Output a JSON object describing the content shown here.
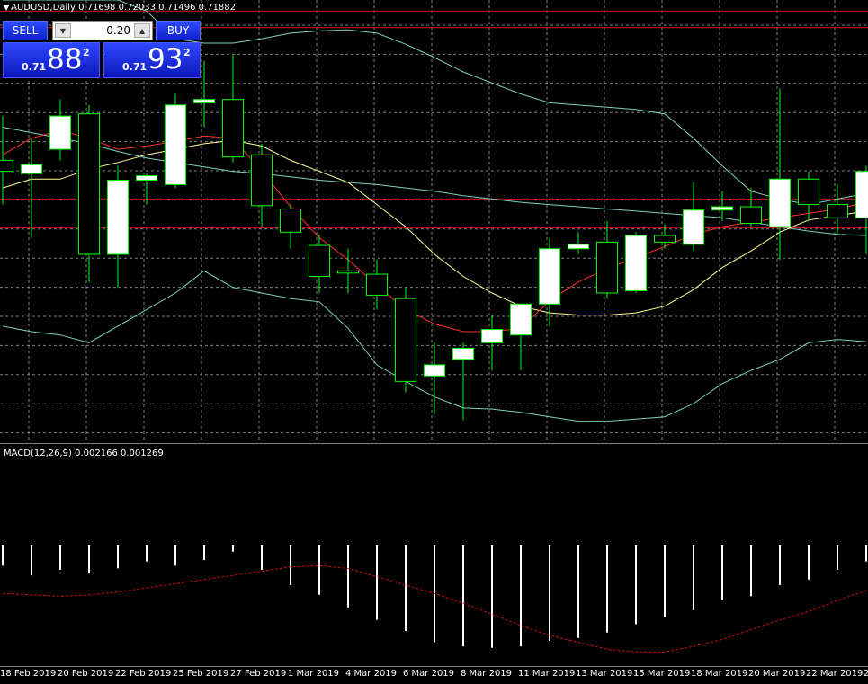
{
  "header": {
    "symbol_title": "AUDUSD,Daily",
    "ohlc": "0.71698 0.72033 0.71496 0.71882"
  },
  "trade_panel": {
    "sell_label": "SELL",
    "buy_label": "BUY",
    "lot": "0.20",
    "sell_price_prefix": "0.71",
    "sell_price_big": "88",
    "sell_price_sup": "2",
    "buy_price_prefix": "0.71",
    "buy_price_big": "93",
    "buy_price_sup": "2"
  },
  "indicator": {
    "title": "MACD(12,26,9) 0.002166 0.001269"
  },
  "colors": {
    "background": "#000000",
    "grid": "#808080",
    "candle_border": "#00ff00",
    "bull_fill": "#ffffff",
    "bear_fill": "#000000",
    "fast_ma": "#ff3030",
    "slow_ma": "#ffff99",
    "bands": "#7fd0c0",
    "red_level": "#d01010",
    "macd_signal": "#cc1111"
  },
  "chart_data": {
    "type": "candlestick",
    "x_labels": [
      "18 Feb 2019",
      "20 Feb 2019",
      "22 Feb 2019",
      "25 Feb 2019",
      "27 Feb 2019",
      "1 Mar 2019",
      "4 Mar 2019",
      "6 Mar 2019",
      "8 Mar 2019",
      "11 Mar 2019",
      "13 Mar 2019",
      "15 Mar 2019",
      "18 Mar 2019",
      "20 Mar 2019",
      "22 Mar 2019",
      "2"
    ],
    "candles": [
      {
        "o": 0.712,
        "h": 0.716,
        "l": 0.708,
        "c": 0.711
      },
      {
        "o": 0.7108,
        "h": 0.714,
        "l": 0.705,
        "c": 0.7116
      },
      {
        "o": 0.713,
        "h": 0.7175,
        "l": 0.712,
        "c": 0.716
      },
      {
        "o": 0.7162,
        "h": 0.717,
        "l": 0.701,
        "c": 0.7035
      },
      {
        "o": 0.7035,
        "h": 0.7115,
        "l": 0.7005,
        "c": 0.7102
      },
      {
        "o": 0.7102,
        "h": 0.7108,
        "l": 0.708,
        "c": 0.7106
      },
      {
        "o": 0.7098,
        "h": 0.718,
        "l": 0.7095,
        "c": 0.717
      },
      {
        "o": 0.7172,
        "h": 0.721,
        "l": 0.715,
        "c": 0.7175
      },
      {
        "o": 0.7175,
        "h": 0.7215,
        "l": 0.7118,
        "c": 0.7123
      },
      {
        "o": 0.7125,
        "h": 0.7135,
        "l": 0.706,
        "c": 0.7079
      },
      {
        "o": 0.7076,
        "h": 0.708,
        "l": 0.704,
        "c": 0.7055
      },
      {
        "o": 0.7043,
        "h": 0.7053,
        "l": 0.7,
        "c": 0.7015
      },
      {
        "o": 0.702,
        "h": 0.704,
        "l": 0.7,
        "c": 0.7018
      },
      {
        "o": 0.7017,
        "h": 0.703,
        "l": 0.6985,
        "c": 0.6998
      },
      {
        "o": 0.6995,
        "h": 0.7005,
        "l": 0.691,
        "c": 0.692
      },
      {
        "o": 0.6925,
        "h": 0.6955,
        "l": 0.689,
        "c": 0.6935
      },
      {
        "o": 0.694,
        "h": 0.6955,
        "l": 0.6885,
        "c": 0.695
      },
      {
        "o": 0.6955,
        "h": 0.698,
        "l": 0.693,
        "c": 0.6967
      },
      {
        "o": 0.6962,
        "h": 0.699,
        "l": 0.693,
        "c": 0.699
      },
      {
        "o": 0.699,
        "h": 0.705,
        "l": 0.697,
        "c": 0.704
      },
      {
        "o": 0.704,
        "h": 0.7055,
        "l": 0.7035,
        "c": 0.7044
      },
      {
        "o": 0.7046,
        "h": 0.7065,
        "l": 0.6995,
        "c": 0.7
      },
      {
        "o": 0.7002,
        "h": 0.7055,
        "l": 0.7,
        "c": 0.7052
      },
      {
        "o": 0.7052,
        "h": 0.7062,
        "l": 0.704,
        "c": 0.7046
      },
      {
        "o": 0.7044,
        "h": 0.71,
        "l": 0.7038,
        "c": 0.7075
      },
      {
        "o": 0.7075,
        "h": 0.7092,
        "l": 0.7065,
        "c": 0.7078
      },
      {
        "o": 0.7078,
        "h": 0.7095,
        "l": 0.706,
        "c": 0.7063
      },
      {
        "o": 0.706,
        "h": 0.7185,
        "l": 0.703,
        "c": 0.7103
      },
      {
        "o": 0.7103,
        "h": 0.711,
        "l": 0.7065,
        "c": 0.708
      },
      {
        "o": 0.708,
        "h": 0.7098,
        "l": 0.7053,
        "c": 0.7068
      },
      {
        "o": 0.7068,
        "h": 0.7115,
        "l": 0.7035,
        "c": 0.711
      }
    ],
    "ma_fast": [
      0.7125,
      0.714,
      0.7147,
      0.714,
      0.713,
      0.7133,
      0.7137,
      0.7142,
      0.714,
      0.711,
      0.7078,
      0.705,
      0.703,
      0.7007,
      0.6985,
      0.6972,
      0.6965,
      0.6965,
      0.6968,
      0.6993,
      0.701,
      0.7022,
      0.7032,
      0.7042,
      0.7053,
      0.706,
      0.7064,
      0.7068,
      0.7072,
      0.7076,
      0.7082
    ],
    "ma_slow": [
      0.7095,
      0.7103,
      0.7103,
      0.7112,
      0.7118,
      0.7125,
      0.713,
      0.7135,
      0.7138,
      0.7133,
      0.712,
      0.711,
      0.71,
      0.708,
      0.706,
      0.7035,
      0.7015,
      0.7,
      0.6988,
      0.6982,
      0.698,
      0.698,
      0.6982,
      0.6988,
      0.7003,
      0.7023,
      0.7038,
      0.7055,
      0.7066,
      0.707,
      0.7074
    ],
    "band_mid": [
      0.715,
      0.7145,
      0.714,
      0.7135,
      0.7128,
      0.7122,
      0.7118,
      0.7114,
      0.711,
      0.7108,
      0.7105,
      0.7102,
      0.71,
      0.7098,
      0.7095,
      0.7092,
      0.7088,
      0.7085,
      0.7082,
      0.708,
      0.7078,
      0.7076,
      0.7074,
      0.7072,
      0.707,
      0.7068,
      0.7064,
      0.706,
      0.7056,
      0.7053,
      0.7052
    ],
    "band_upper": [
      0.7265,
      0.7265,
      0.7265,
      0.7265,
      0.7265,
      0.7255,
      0.723,
      0.7226,
      0.7226,
      0.723,
      0.7235,
      0.7237,
      0.7238,
      0.7235,
      0.7225,
      0.7213,
      0.72,
      0.719,
      0.718,
      0.7172,
      0.717,
      0.7168,
      0.7166,
      0.7162,
      0.714,
      0.7115,
      0.7092,
      0.7085,
      0.708,
      0.7085,
      0.709
    ],
    "band_lower": [
      0.697,
      0.6965,
      0.6962,
      0.6955,
      0.697,
      0.6985,
      0.7,
      0.702,
      0.7005,
      0.7,
      0.6995,
      0.6992,
      0.6968,
      0.6935,
      0.692,
      0.6906,
      0.6896,
      0.6895,
      0.6892,
      0.6888,
      0.6884,
      0.6884,
      0.6886,
      0.6888,
      0.69,
      0.6918,
      0.693,
      0.694,
      0.6955,
      0.6958,
      0.6956
    ],
    "red_levels": [
      0.7255,
      0.724,
      0.7085,
      0.7059
    ],
    "price_range": [
      0.6865,
      0.7265
    ],
    "macd_histogram": [
      -0.0015,
      -0.0022,
      -0.0018,
      -0.002,
      -0.0017,
      -0.0012,
      -0.0015,
      -0.0011,
      -0.0005,
      -0.0018,
      -0.0029,
      -0.0036,
      -0.0045,
      -0.0054,
      -0.0062,
      -0.007,
      -0.0073,
      -0.0074,
      -0.0073,
      -0.0069,
      -0.0067,
      -0.0063,
      -0.0057,
      -0.0052,
      -0.0047,
      -0.004,
      -0.0037,
      -0.0029,
      -0.0025,
      -0.0018,
      -0.0012
    ],
    "macd_signal": [
      -0.0035,
      -0.0036,
      -0.0037,
      -0.0036,
      -0.0034,
      -0.0031,
      -0.0028,
      -0.0025,
      -0.0022,
      -0.0019,
      -0.0016,
      -0.0015,
      -0.0017,
      -0.0023,
      -0.0029,
      -0.0035,
      -0.0042,
      -0.005,
      -0.0058,
      -0.0065,
      -0.007,
      -0.0075,
      -0.0077,
      -0.0077,
      -0.0073,
      -0.0068,
      -0.0061,
      -0.0054,
      -0.0048,
      -0.004,
      -0.0033
    ],
    "macd_range": [
      -0.008,
      0.0
    ]
  }
}
